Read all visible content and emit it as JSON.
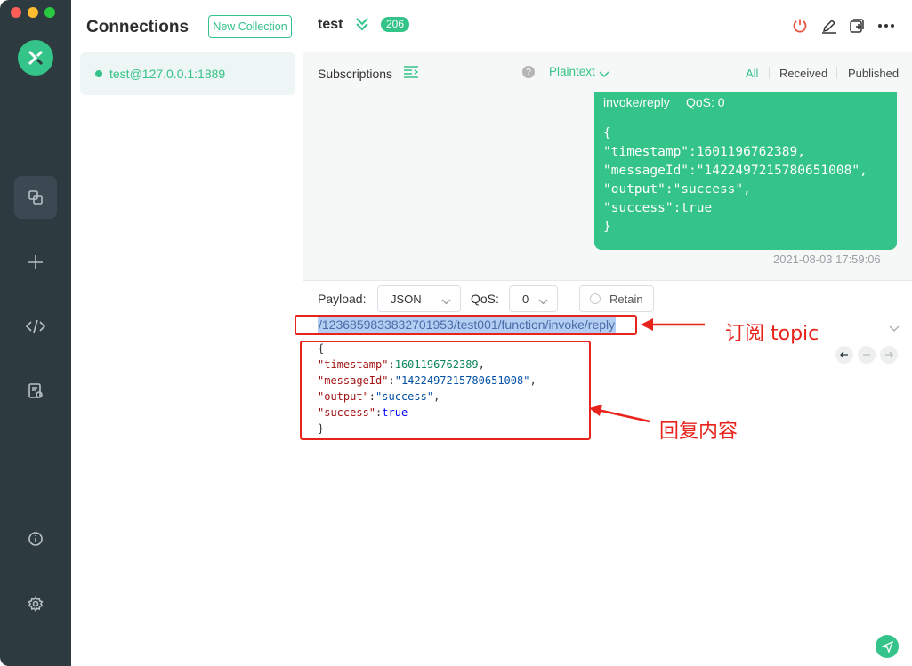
{
  "sidebar_rail": {
    "items": [
      "connections-icon",
      "add-icon",
      "script-icon",
      "log-icon",
      "info-icon",
      "settings-icon"
    ]
  },
  "connections_panel": {
    "title": "Connections",
    "new_collection_label": "New Collection",
    "items": [
      {
        "label": "test@127.0.0.1:1889"
      }
    ]
  },
  "topbar": {
    "title": "test",
    "badge": "206"
  },
  "subbar": {
    "subscriptions_label": "Subscriptions",
    "payload_format": "Plaintext",
    "filters": [
      "All",
      "Received",
      "Published"
    ]
  },
  "message": {
    "topic_tail": "invoke/reply",
    "qos": "QoS: 0",
    "payload": "{\n\"timestamp\":1601196762389,\n\"messageId\":\"1422497215780651008\",\n\"output\":\"success\",\n\"success\":true\n}",
    "time": "2021-08-03 17:59:06"
  },
  "composer": {
    "payload_label": "Payload:",
    "payload_type": "JSON",
    "qos_label": "QoS:",
    "qos_value": "0",
    "retain_label": "Retain",
    "topic": "/1236859833832701953/test001/function/invoke/reply",
    "code_lines": [
      [
        {
          "t": "{",
          "c": ""
        }
      ],
      [
        {
          "t": "\"timestamp\"",
          "c": "k"
        },
        {
          "t": ":",
          "c": ""
        },
        {
          "t": "1601196762389",
          "c": "n"
        },
        {
          "t": ",",
          "c": ""
        }
      ],
      [
        {
          "t": "\"messageId\"",
          "c": "k"
        },
        {
          "t": ":",
          "c": ""
        },
        {
          "t": "\"1422497215780651008\"",
          "c": "s"
        },
        {
          "t": ",",
          "c": ""
        }
      ],
      [
        {
          "t": "\"output\"",
          "c": "k"
        },
        {
          "t": ":",
          "c": ""
        },
        {
          "t": "\"success\"",
          "c": "s"
        },
        {
          "t": ",",
          "c": ""
        }
      ],
      [
        {
          "t": "\"success\"",
          "c": "k"
        },
        {
          "t": ":",
          "c": ""
        },
        {
          "t": "true",
          "c": "bl"
        }
      ],
      [
        {
          "t": "}",
          "c": ""
        }
      ]
    ]
  },
  "annotations": {
    "topic_note": "订阅 topic",
    "reply_note": "回复内容",
    "color": "#e8231c"
  },
  "colors": {
    "accent": "#34c388",
    "rail": "#2d3a40"
  }
}
